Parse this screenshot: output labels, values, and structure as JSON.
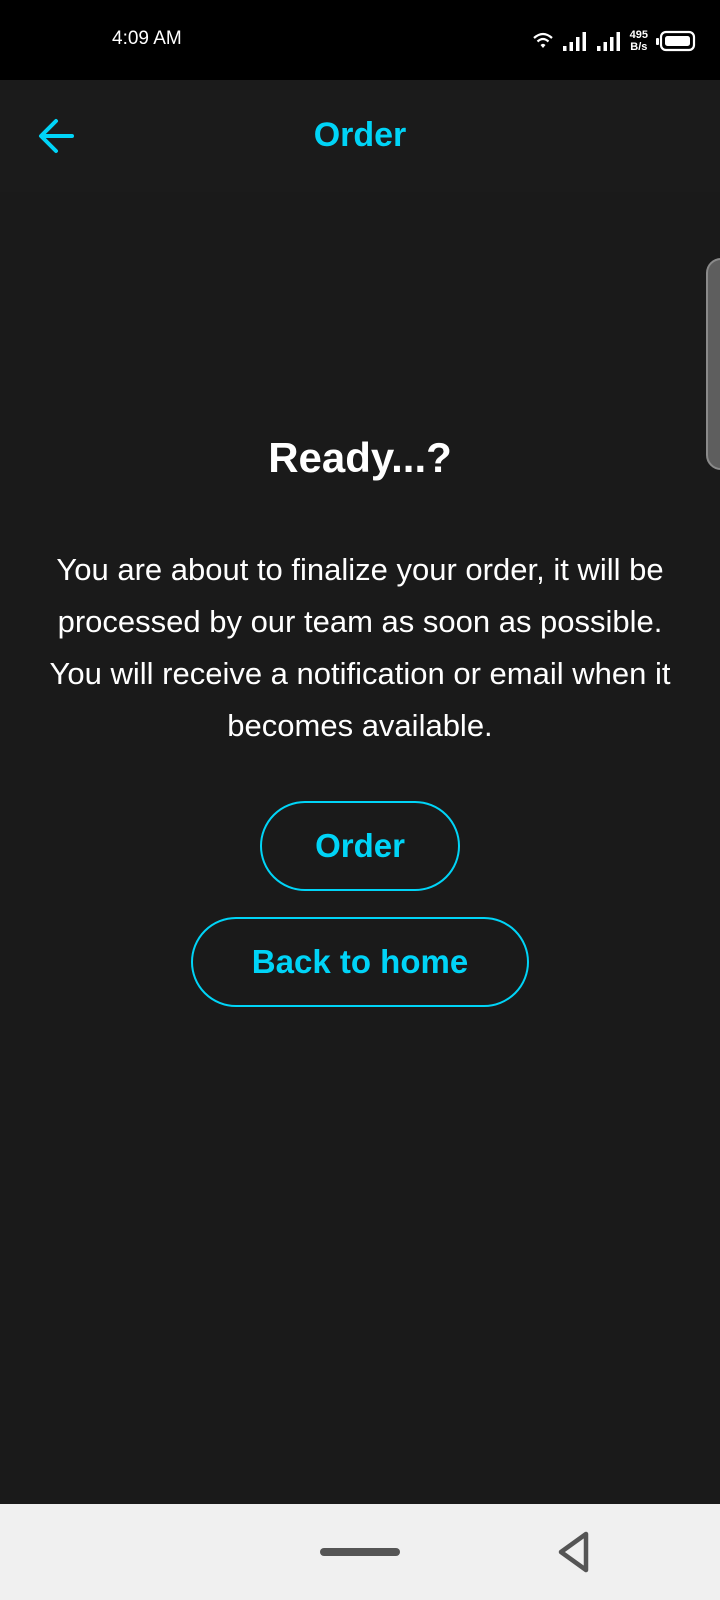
{
  "status_bar": {
    "time": "4:09 AM",
    "net_speed_value": "495",
    "net_speed_unit": "B/s",
    "icons": [
      "wifi-icon",
      "signal-icon",
      "signal-icon",
      "battery-icon"
    ]
  },
  "app_bar": {
    "title": "Order",
    "back_icon": "arrow-left-icon"
  },
  "content": {
    "headline": "Ready...?",
    "message": "You are about to finalize your order, it will be processed by our team as soon as possible. You will receive a notification or email when it becomes available.",
    "order_button_label": "Order",
    "home_button_label": "Back to home"
  },
  "nav_bar": {
    "icons": [
      "home-pill-icon",
      "back-triangle-icon"
    ]
  },
  "colors": {
    "background": "#1a1a1a",
    "accent": "#00d4f7",
    "status_bar": "#000000",
    "nav_bar": "#f0f0f0"
  }
}
